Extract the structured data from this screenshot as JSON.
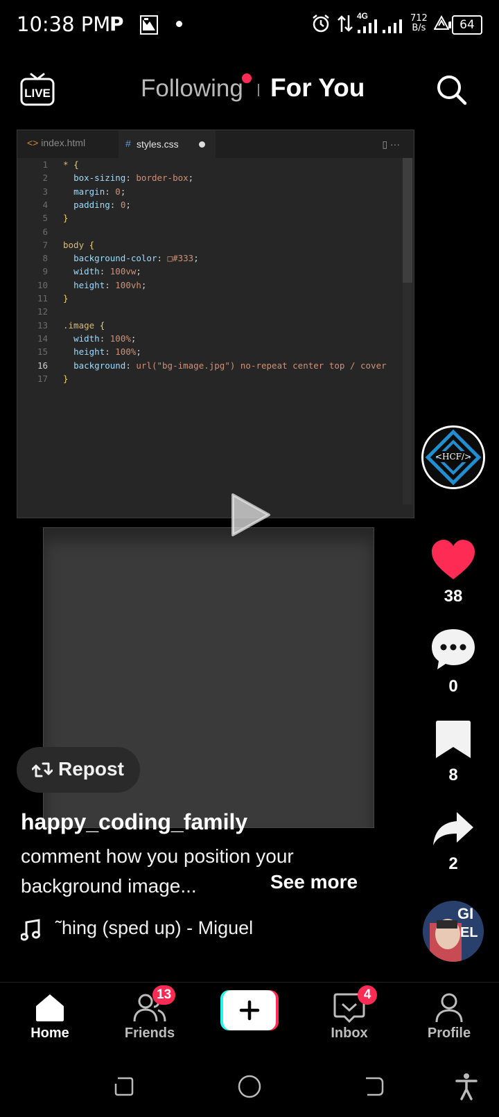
{
  "status_bar": {
    "time": "10:38 PM",
    "p_icon": "P",
    "network": "4G",
    "speed_value": "712",
    "speed_unit": "B/s",
    "battery": "64"
  },
  "top_nav": {
    "live_label": "LIVE",
    "following_label": "Following",
    "for_you_label": "For You"
  },
  "editor": {
    "tab1": "index.html",
    "tab2": "styles.css",
    "lines": [
      {
        "n": "1",
        "text": "* {"
      },
      {
        "n": "2",
        "text": "  box-sizing: border-box;"
      },
      {
        "n": "3",
        "text": "  margin: 0;"
      },
      {
        "n": "4",
        "text": "  padding: 0;"
      },
      {
        "n": "5",
        "text": "}"
      },
      {
        "n": "6",
        "text": ""
      },
      {
        "n": "7",
        "text": "body {"
      },
      {
        "n": "8",
        "text": "  background-color: □#333;"
      },
      {
        "n": "9",
        "text": "  width: 100vw;"
      },
      {
        "n": "10",
        "text": "  height: 100vh;"
      },
      {
        "n": "11",
        "text": "}"
      },
      {
        "n": "12",
        "text": ""
      },
      {
        "n": "13",
        "text": ".image {"
      },
      {
        "n": "14",
        "text": "  width: 100%;"
      },
      {
        "n": "15",
        "text": "  height: 100%;"
      },
      {
        "n": "16",
        "text": "  background: url(\"bg-image.jpg\") no-repeat center top / cover"
      },
      {
        "n": "17",
        "text": "}"
      }
    ]
  },
  "creator": {
    "avatar_text": "<HCF/>"
  },
  "actions": {
    "likes": "38",
    "comments": "0",
    "saves": "8",
    "shares": "2"
  },
  "post": {
    "repost_label": "Repost",
    "username": "happy_coding_family",
    "caption_line1": "comment how you position your",
    "caption_line2": "background image...",
    "see_more": "See more",
    "music": "˜hing (sped up) - Miguel"
  },
  "bottom_nav": {
    "home": "Home",
    "friends": "Friends",
    "friends_badge": "13",
    "inbox": "Inbox",
    "inbox_badge": "4",
    "profile": "Profile"
  },
  "colors": {
    "accent": "#fe2c55",
    "background": "#000000"
  }
}
